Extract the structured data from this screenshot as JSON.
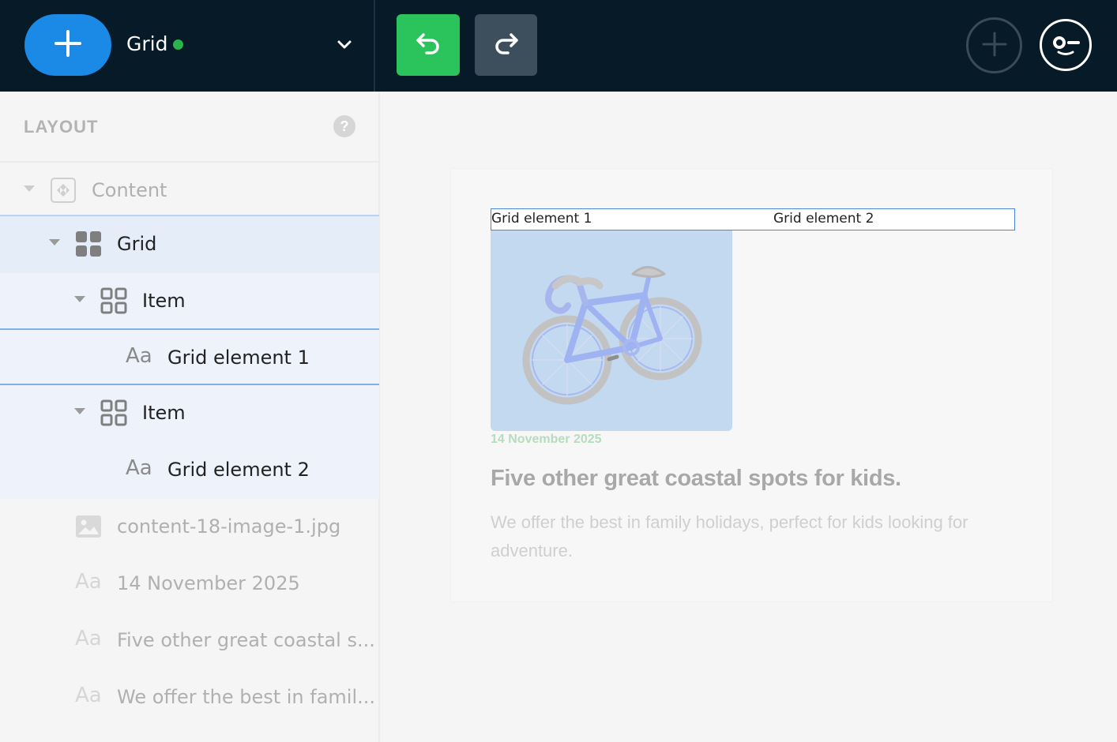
{
  "topbar": {
    "document_title": "Grid",
    "colors": {
      "background": "#061a27",
      "add": "#1a8ae6",
      "undo": "#2ac35c",
      "redo": "#3d4f5c",
      "status": "#2ab54a"
    },
    "icons": [
      "plus-icon",
      "chevron-down-icon",
      "undo-icon",
      "redo-icon",
      "add-circle-icon",
      "user-avatar-icon"
    ]
  },
  "sidebar": {
    "title": "LAYOUT",
    "help": "?",
    "tree": [
      {
        "label": "Content",
        "icon": "content-block-icon"
      },
      {
        "label": "Grid",
        "icon": "grid-icon"
      },
      {
        "label": "Item",
        "icon": "grid-item-icon"
      },
      {
        "label": "Grid element 1",
        "icon": "text-icon",
        "glyph": "Aa"
      },
      {
        "label": "Item",
        "icon": "grid-item-icon"
      },
      {
        "label": "Grid element 2",
        "icon": "text-icon",
        "glyph": "Aa"
      },
      {
        "label": "content-18-image-1.jpg",
        "icon": "image-icon"
      },
      {
        "label": "14 November 2025",
        "icon": "text-icon",
        "glyph": "Aa"
      },
      {
        "label": "Five other great coastal s...",
        "icon": "text-icon",
        "glyph": "Aa"
      },
      {
        "label": "We offer the best in famil...",
        "icon": "text-icon",
        "glyph": "Aa"
      }
    ]
  },
  "canvas": {
    "grid_element_1": "Grid element 1",
    "grid_element_2": "Grid element 2",
    "date": "14 November 2025",
    "title": "Five other great coastal spots for kids.",
    "description": "We offer the best in family holidays, perfect for kids looking for adventure."
  }
}
